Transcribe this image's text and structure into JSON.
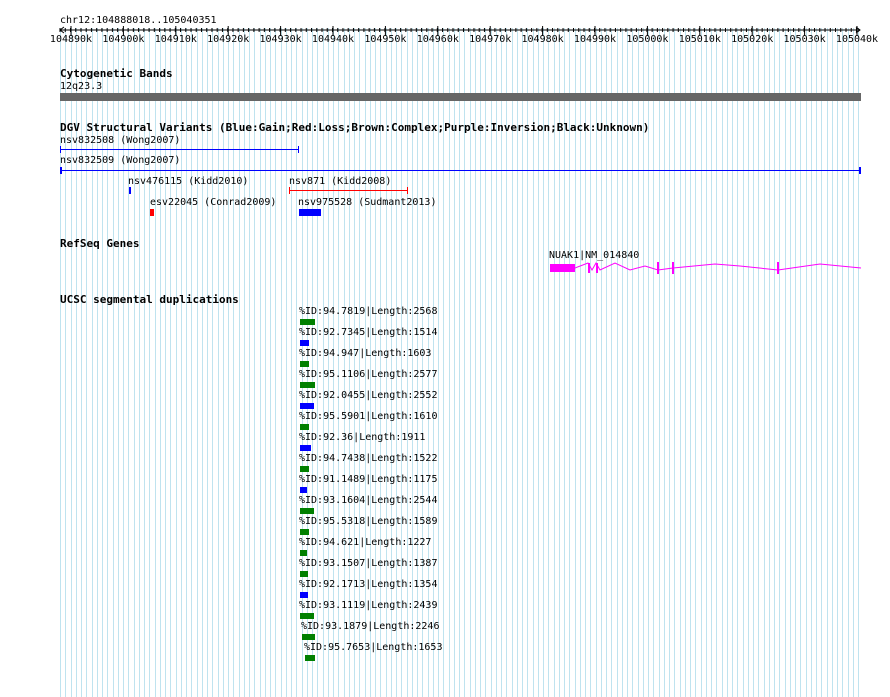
{
  "location": "chr12:104888018..105040351",
  "ruler": {
    "ticks": [
      "104890k",
      "104900k",
      "104910k",
      "104920k",
      "104930k",
      "104940k",
      "104950k",
      "104960k",
      "104970k",
      "104980k",
      "104990k",
      "105000k",
      "105010k",
      "105020k",
      "105030k",
      "105040k"
    ]
  },
  "tracks": {
    "cytoband": {
      "title": "Cytogenetic Bands",
      "band_label": "12q23.3",
      "color": "#666666"
    },
    "dgv": {
      "title": "DGV Structural Variants (Blue:Gain;Red:Loss;Brown:Complex;Purple:Inversion;Black:Unknown)",
      "features": [
        {
          "label": "nsv832508 (Wong2007)",
          "type": "gain",
          "color": "#0000ff"
        },
        {
          "label": "nsv832509 (Wong2007)",
          "type": "gain",
          "color": "#0000ff"
        },
        {
          "label": "nsv476115 (Kidd2010)",
          "type": "gain",
          "color": "#0000ff"
        },
        {
          "label": "nsv871 (Kidd2008)",
          "type": "loss",
          "color": "#ff0000"
        },
        {
          "label": "esv22045 (Conrad2009)",
          "type": "loss",
          "color": "#ff0000"
        },
        {
          "label": "nsv975528 (Sudmant2013)",
          "type": "gain",
          "color": "#0000ff"
        }
      ]
    },
    "refseq": {
      "title": "RefSeq Genes",
      "gene_label": "NUAK1|NM_014840",
      "color": "#ff00ff"
    },
    "segdups": {
      "title": "UCSC segmental duplications",
      "items": [
        {
          "label": "%ID:94.7819|Length:2568",
          "color": "#008000"
        },
        {
          "label": "%ID:92.7345|Length:1514",
          "color": "#0000ff"
        },
        {
          "label": "%ID:94.947|Length:1603",
          "color": "#008000"
        },
        {
          "label": "%ID:95.1106|Length:2577",
          "color": "#008000"
        },
        {
          "label": "%ID:92.0455|Length:2552",
          "color": "#0000ff"
        },
        {
          "label": "%ID:95.5901|Length:1610",
          "color": "#008000"
        },
        {
          "label": "%ID:92.36|Length:1911",
          "color": "#0000ff"
        },
        {
          "label": "%ID:94.7438|Length:1522",
          "color": "#008000"
        },
        {
          "label": "%ID:91.1489|Length:1175",
          "color": "#0000ff"
        },
        {
          "label": "%ID:93.1604|Length:2544",
          "color": "#008000"
        },
        {
          "label": "%ID:95.5318|Length:1589",
          "color": "#008000"
        },
        {
          "label": "%ID:94.621|Length:1227",
          "color": "#008000"
        },
        {
          "label": "%ID:93.1507|Length:1387",
          "color": "#008000"
        },
        {
          "label": "%ID:92.1713|Length:1354",
          "color": "#0000ff"
        },
        {
          "label": "%ID:93.1119|Length:2439",
          "color": "#008000"
        },
        {
          "label": "%ID:93.1879|Length:2246",
          "color": "#008000"
        },
        {
          "label": "%ID:95.7653|Length:1653",
          "color": "#008000"
        }
      ]
    }
  }
}
